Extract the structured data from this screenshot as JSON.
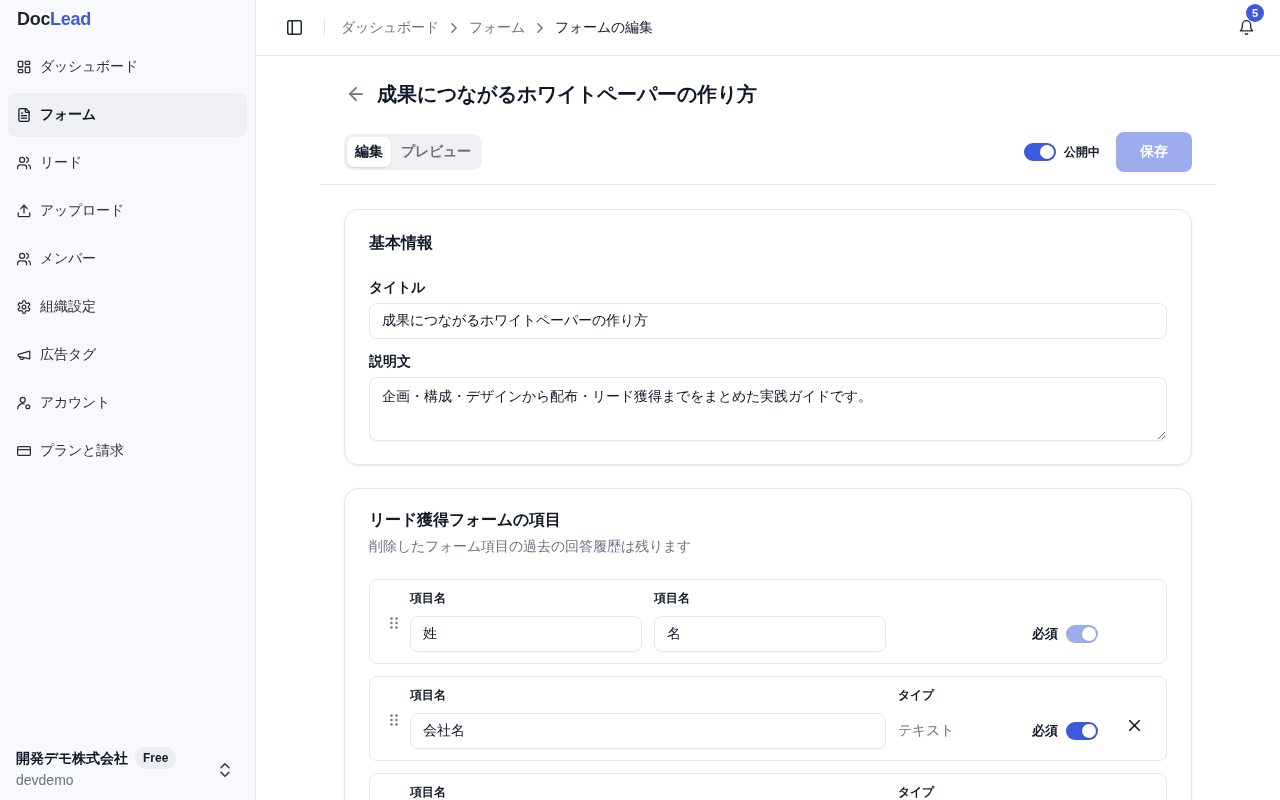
{
  "sidebar": {
    "brand": {
      "prefix": "Doc",
      "accent": "Lead"
    },
    "items": [
      {
        "label": "ダッシュボード",
        "selected": false
      },
      {
        "label": "フォーム",
        "selected": true
      },
      {
        "label": "リード",
        "selected": false
      },
      {
        "label": "アップロード",
        "selected": false
      },
      {
        "label": "メンバー",
        "selected": false
      },
      {
        "label": "組織設定",
        "selected": false
      },
      {
        "label": "広告タグ",
        "selected": false
      },
      {
        "label": "アカウント",
        "selected": false
      },
      {
        "label": "プランと請求",
        "selected": false
      }
    ],
    "organization": {
      "name": "開発デモ株式会社",
      "plan": "Free",
      "handle": "devdemo"
    }
  },
  "topbar": {
    "breadcrumb": [
      {
        "label": "ダッシュボード",
        "current": false
      },
      {
        "label": "フォーム",
        "current": false
      },
      {
        "label": "フォームの編集",
        "current": true
      }
    ],
    "notification_count": "5"
  },
  "page": {
    "title": "成果につながるホワイトペーパーの作り方",
    "tabs": [
      {
        "label": "編集",
        "selected": true
      },
      {
        "label": "プレビュー",
        "selected": false
      }
    ],
    "publish": {
      "label": "公開中",
      "on": true
    },
    "save": {
      "label": "保存",
      "disabled": true
    }
  },
  "basic_info": {
    "heading": "基本情報",
    "fields": [
      {
        "kind": "input",
        "label": "タイトル",
        "value": "成果につながるホワイトペーパーの作り方"
      },
      {
        "kind": "textarea",
        "label": "説明文",
        "value": "企画・構成・デザインから配布・リード獲得までをまとめた実践ガイドです。"
      }
    ]
  },
  "form_items": {
    "heading": "リード獲得フォームの項目",
    "note": "削除したフォーム項目の過去の回答履歴は残ります",
    "rows": [
      {
        "kind": "pair",
        "fields": [
          {
            "label": "項目名",
            "value": "姓"
          },
          {
            "label": "項目名",
            "value": "名"
          }
        ],
        "required": {
          "label": "必須",
          "on": true,
          "disabled": true
        },
        "removable": false
      },
      {
        "kind": "single",
        "fields": [
          {
            "label": "項目名",
            "value": "会社名"
          }
        ],
        "type": {
          "label": "タイプ",
          "value": "テキスト"
        },
        "required": {
          "label": "必須",
          "on": true,
          "disabled": false
        },
        "removable": true
      },
      {
        "kind": "single",
        "fields": [
          {
            "label": "項目名"
          }
        ],
        "type": {
          "label": "タイプ"
        }
      }
    ]
  }
}
